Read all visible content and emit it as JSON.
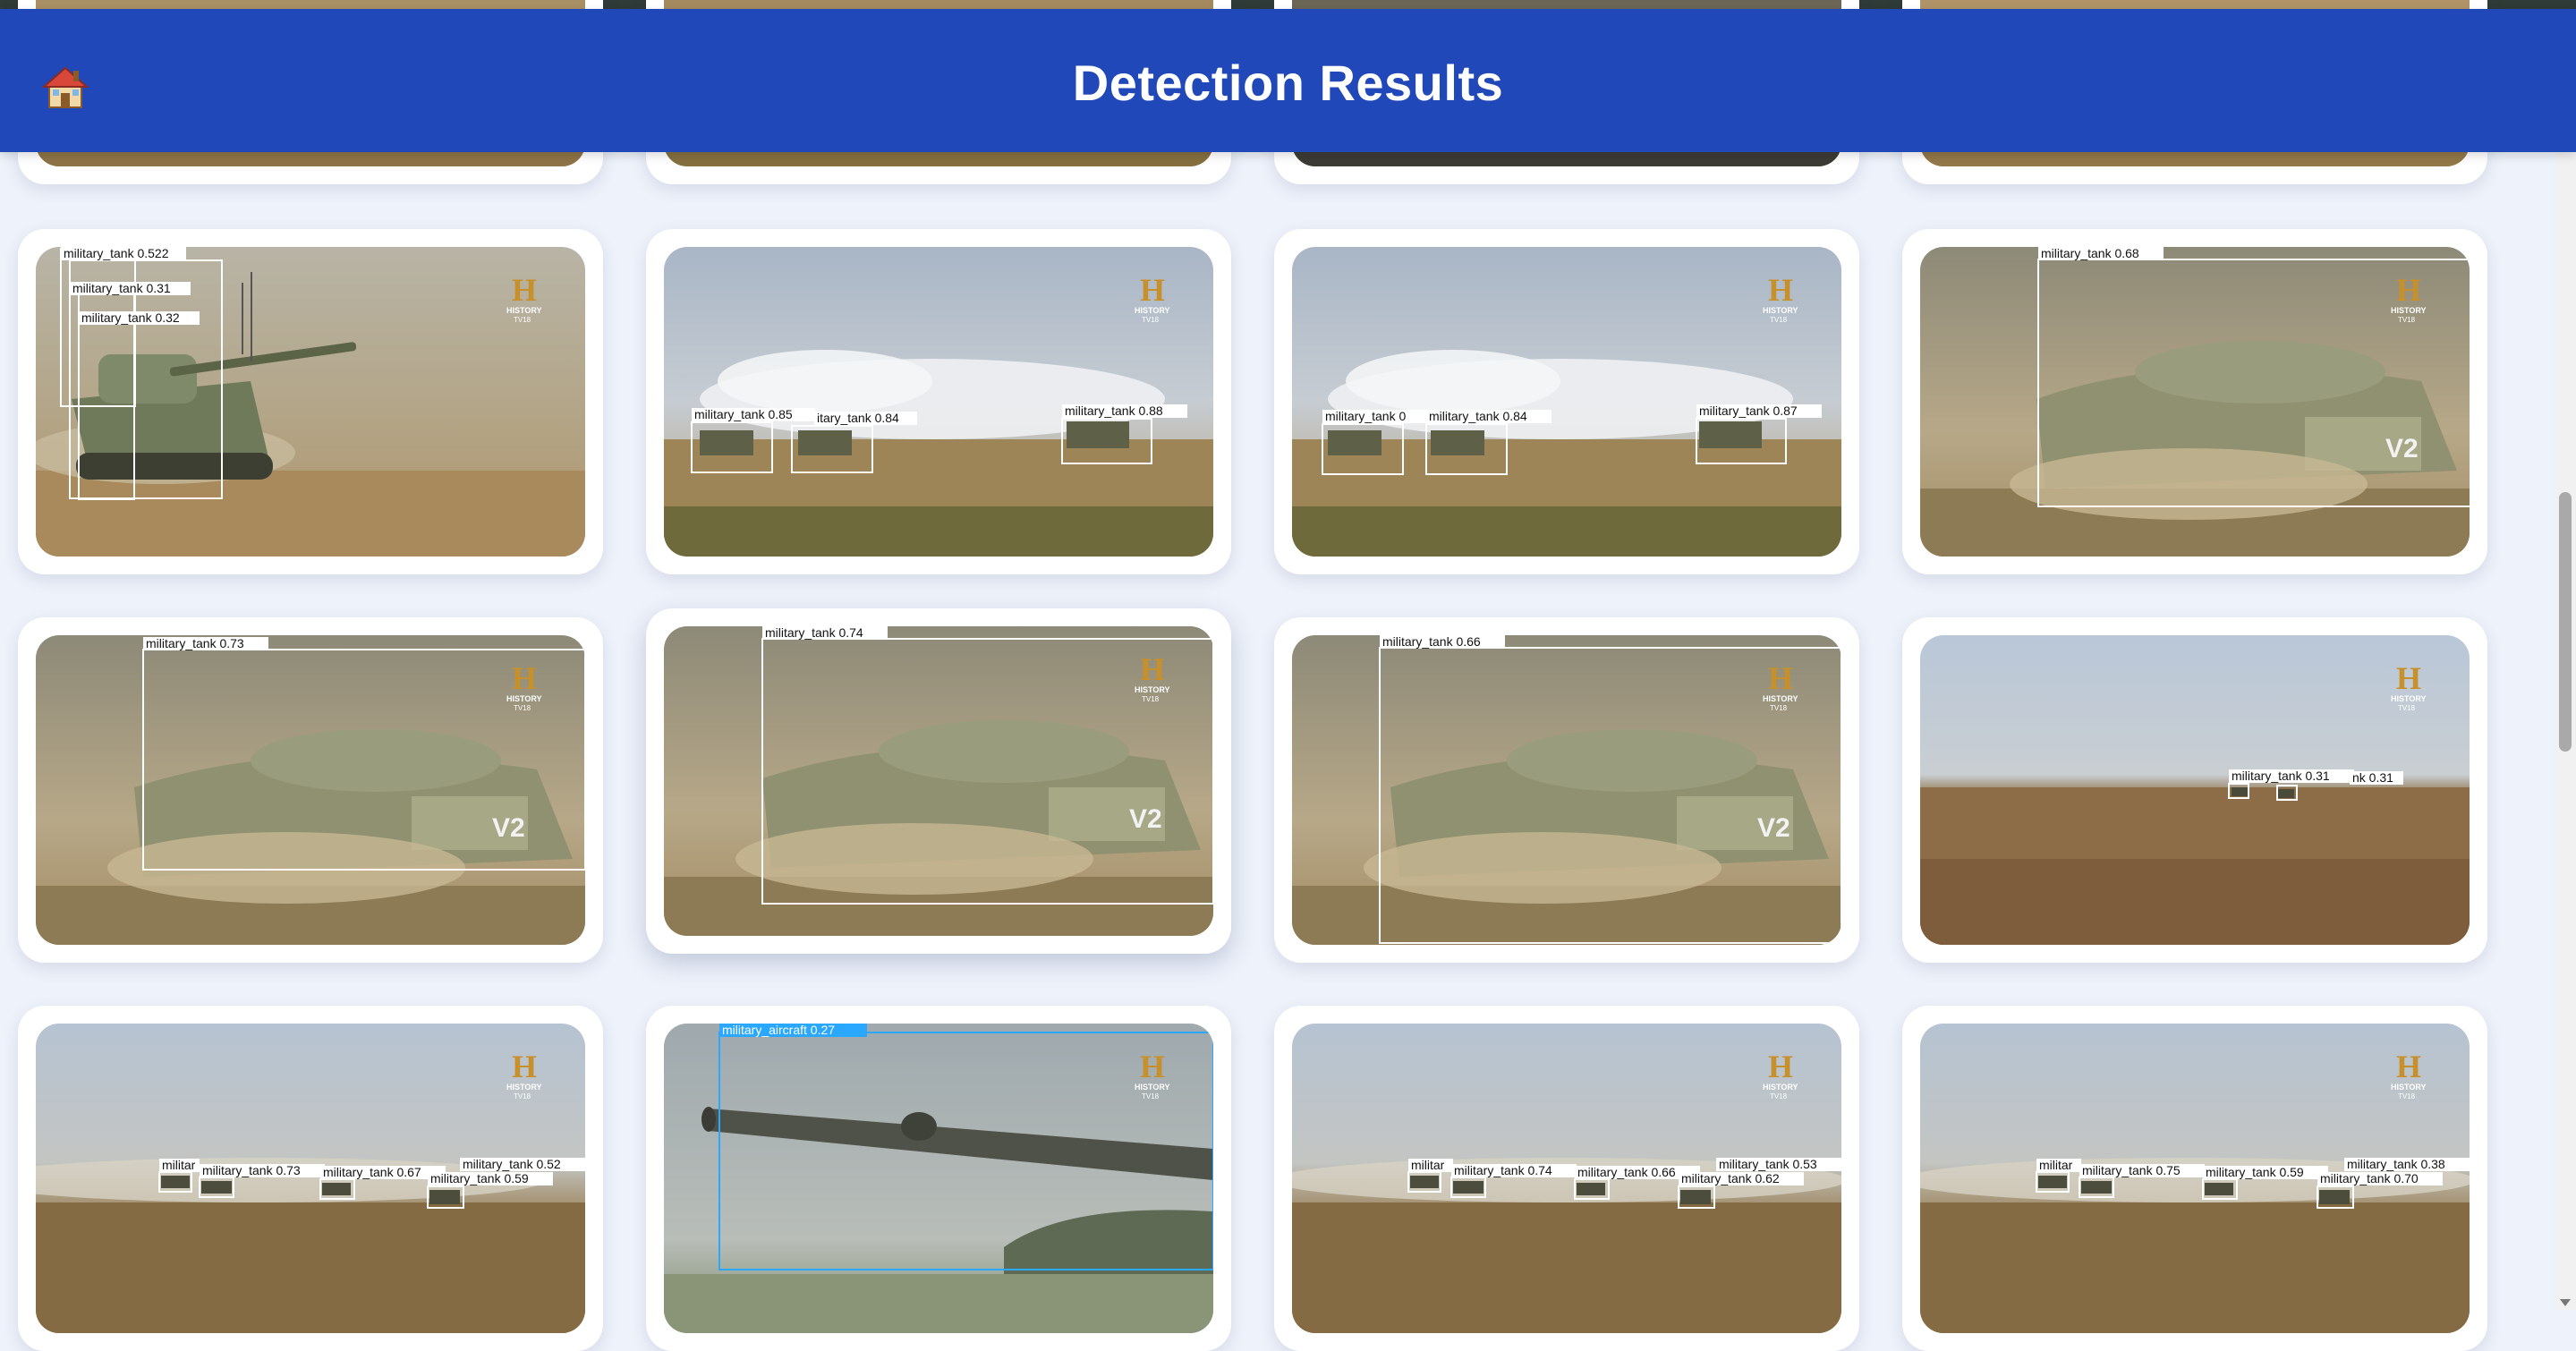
{
  "header": {
    "title": "Detection Results",
    "home_icon": "house-icon"
  },
  "colors": {
    "header_bg": "#2148b8",
    "page_bg": "#eef2fa",
    "tank_box": "#ffffff",
    "aircraft_box": "#2aa8ff"
  },
  "watermark": {
    "letter": "H",
    "line1": "HISTORY",
    "line2": "TV18"
  },
  "results": [
    {
      "scene": "desert",
      "labels": []
    },
    {
      "scene": "desert",
      "labels": []
    },
    {
      "scene": "dark",
      "labels": []
    },
    {
      "scene": "desert",
      "labels": []
    },
    {
      "scene": "tank-closeup-left",
      "labels": [
        "military_tank 0.522",
        "military_tank 0.31",
        "military_tank 0.32"
      ]
    },
    {
      "scene": "smoke-field",
      "labels": [
        "military_tank 0.85",
        "itary_tank 0.84",
        "military_tank 0.88"
      ]
    },
    {
      "scene": "smoke-field",
      "labels": [
        "military_tank 0",
        "military_tank 0.84",
        "military_tank 0.87"
      ]
    },
    {
      "scene": "tank-v2",
      "labels": [
        "military_tank 0.68"
      ]
    },
    {
      "scene": "tank-v2",
      "labels": [
        "military_tank 0.73"
      ]
    },
    {
      "scene": "tank-v2",
      "labels": [
        "military_tank 0.74"
      ]
    },
    {
      "scene": "tank-v2",
      "labels": [
        "military_tank 0.66"
      ]
    },
    {
      "scene": "plain",
      "labels": [
        "military_tank 0.31",
        "nk 0.31"
      ]
    },
    {
      "scene": "convoy",
      "labels": [
        "militar",
        "military_tank 0.73",
        "military_tank 0.67",
        "military_tank 0.59",
        "military_tank 0.52"
      ]
    },
    {
      "scene": "barrel",
      "labels": [
        "military_aircraft 0.27"
      ]
    },
    {
      "scene": "convoy",
      "labels": [
        "militar",
        "military_tank 0.74",
        "military_tank 0.66",
        "military_tank 0.62",
        "military_tank 0.53"
      ]
    },
    {
      "scene": "convoy",
      "labels": [
        "militar",
        "military_tank 0.75",
        "military_tank 0.59",
        "military_tank 0.70",
        "military_tank 0.38"
      ]
    }
  ]
}
